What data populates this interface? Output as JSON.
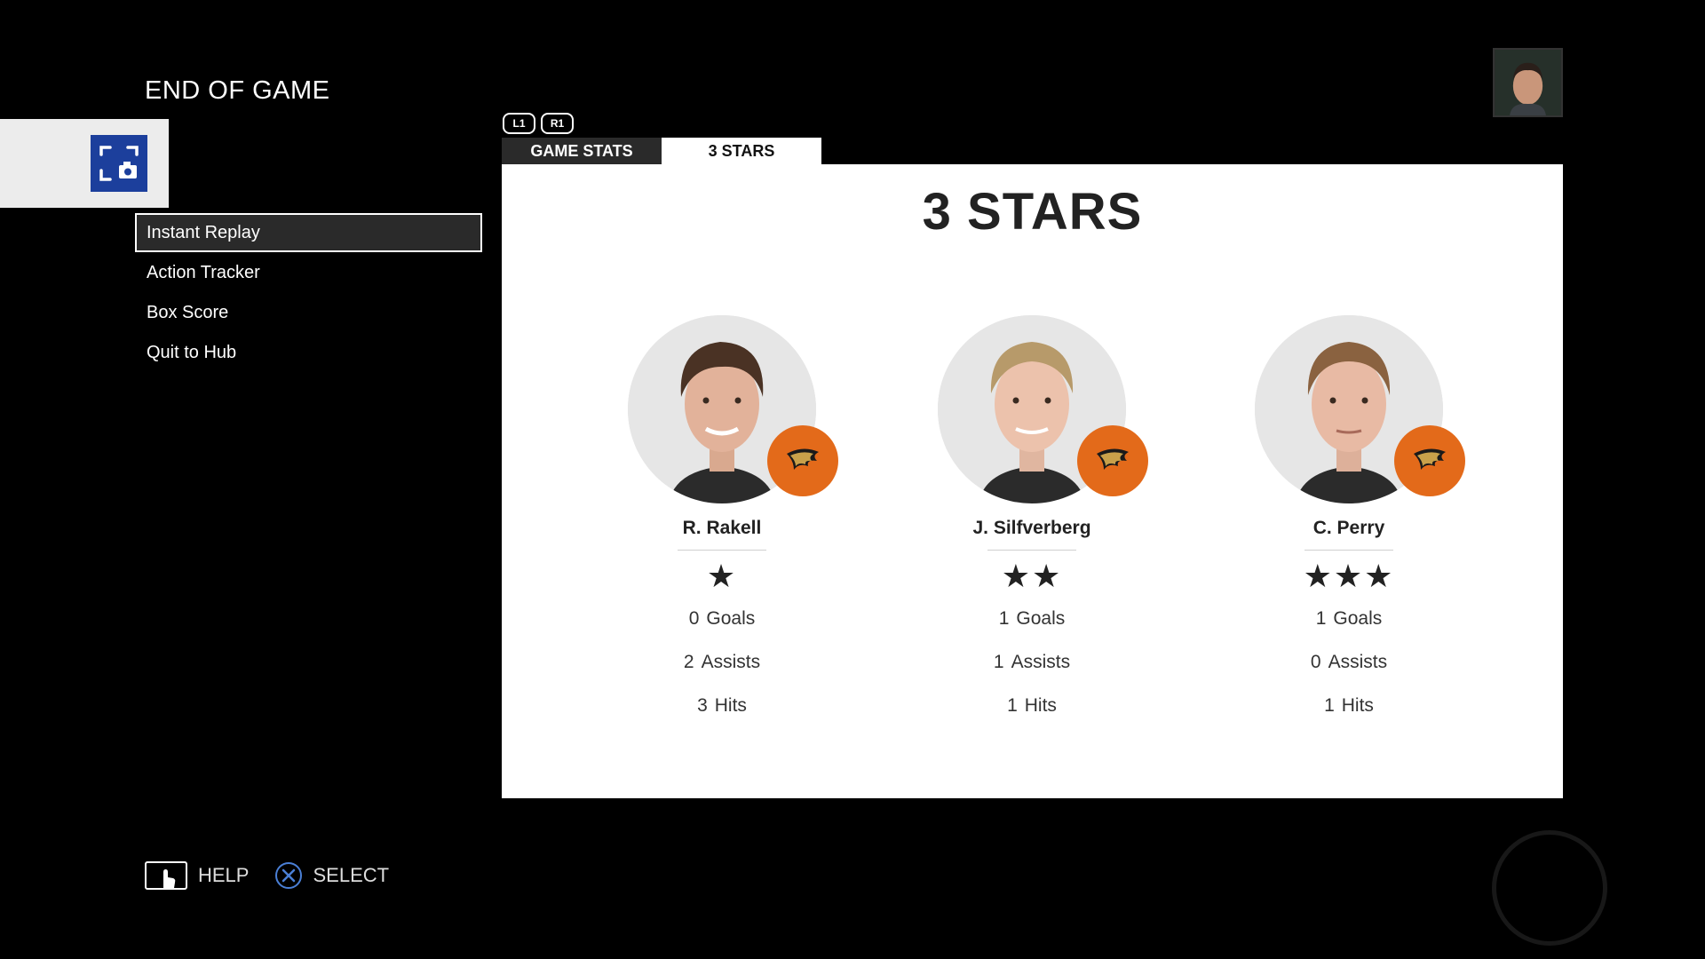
{
  "screen": {
    "title": "END OF GAME"
  },
  "menu": {
    "items": [
      {
        "label": "Instant Replay",
        "selected": true
      },
      {
        "label": "Action Tracker",
        "selected": false
      },
      {
        "label": "Box Score",
        "selected": false
      },
      {
        "label": "Quit to Hub",
        "selected": false
      }
    ]
  },
  "bumpers": {
    "left": "L1",
    "right": "R1"
  },
  "tabs": [
    {
      "label": "GAME STATS",
      "active": false
    },
    {
      "label": "3 STARS",
      "active": true
    }
  ],
  "panel": {
    "title": "3 STARS",
    "players": [
      {
        "name": "R. Rakell",
        "stars": "★",
        "star_count": 1,
        "goals": "0",
        "goals_label": "Goals",
        "assists": "2",
        "assists_label": "Assists",
        "hits": "3",
        "hits_label": "Hits"
      },
      {
        "name": "J. Silfverberg",
        "stars": "★★",
        "star_count": 2,
        "goals": "1",
        "goals_label": "Goals",
        "assists": "1",
        "assists_label": "Assists",
        "hits": "1",
        "hits_label": "Hits"
      },
      {
        "name": "C. Perry",
        "stars": "★★★",
        "star_count": 3,
        "goals": "1",
        "goals_label": "Goals",
        "assists": "0",
        "assists_label": "Assists",
        "hits": "1",
        "hits_label": "Hits"
      }
    ]
  },
  "footer": {
    "help_label": "HELP",
    "select_label": "SELECT"
  },
  "colors": {
    "team_orange": "#e36a1a",
    "capture_blue": "#1c3f9c",
    "cross_blue": "#4a7fd6"
  },
  "icons": {
    "capture": "screenshot-camera-icon",
    "team": "ducks-logo-icon",
    "help": "touchpad-icon",
    "select": "cross-button-icon",
    "brand": "ea-sports-logo"
  }
}
